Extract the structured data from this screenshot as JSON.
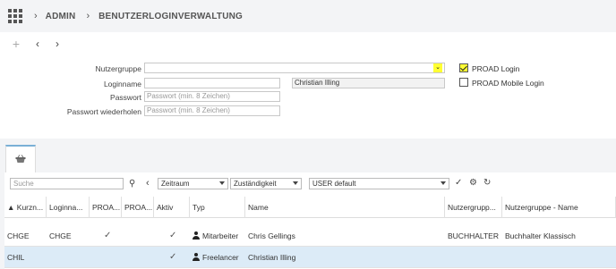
{
  "breadcrumb": {
    "items": [
      "ADMIN",
      "BENUTZERLOGINVERWALTUNG"
    ]
  },
  "toolbar": {
    "add": "+",
    "prev": "‹",
    "next": "›"
  },
  "form": {
    "nutzergruppe": {
      "label": "Nutzergruppe",
      "value": ""
    },
    "loginname": {
      "label": "Loginname",
      "value": ""
    },
    "display_name": "Christian Illing",
    "passwort": {
      "label": "Passwort",
      "placeholder": "Passwort (min. 8 Zeichen)"
    },
    "passwort_wiederholen": {
      "label": "Passwort wiederholen",
      "placeholder": "Passwort (min. 8 Zeichen)"
    },
    "proad_login": {
      "label": "PROAD Login",
      "checked": true
    },
    "proad_mobile_login": {
      "label": "PROAD Mobile Login",
      "checked": false
    }
  },
  "filters": {
    "search_placeholder": "Suche",
    "zeitraum": "Zeitraum",
    "zustaendigkeit": "Zuständigkeit",
    "view": "USER default"
  },
  "table": {
    "columns": [
      "▲ Kurzn...",
      "Loginna...",
      "PROA...",
      "PROA...",
      "Aktiv",
      "Typ",
      "Name",
      "Nutzergrupp...",
      "Nutzergruppe - Name"
    ],
    "rows": [
      {
        "kurzname": "CHGE",
        "loginname": "CHGE",
        "proad1": "✓",
        "proad2": "",
        "aktiv": "✓",
        "typ": "Mitarbeiter",
        "name": "Chris Gellings",
        "nutzergruppe": "BUCHHALTER",
        "nutzergruppe_name": "Buchhalter Klassisch"
      },
      {
        "kurzname": "CHIL",
        "loginname": "",
        "proad1": "",
        "proad2": "",
        "aktiv": "✓",
        "typ": "Freelancer",
        "name": "Christian Illing",
        "nutzergruppe": "",
        "nutzergruppe_name": ""
      }
    ]
  },
  "colors": {
    "highlight_yellow": "#ffff33",
    "selected_row": "#dcebf7",
    "tab_accent": "#7ab0d6"
  }
}
